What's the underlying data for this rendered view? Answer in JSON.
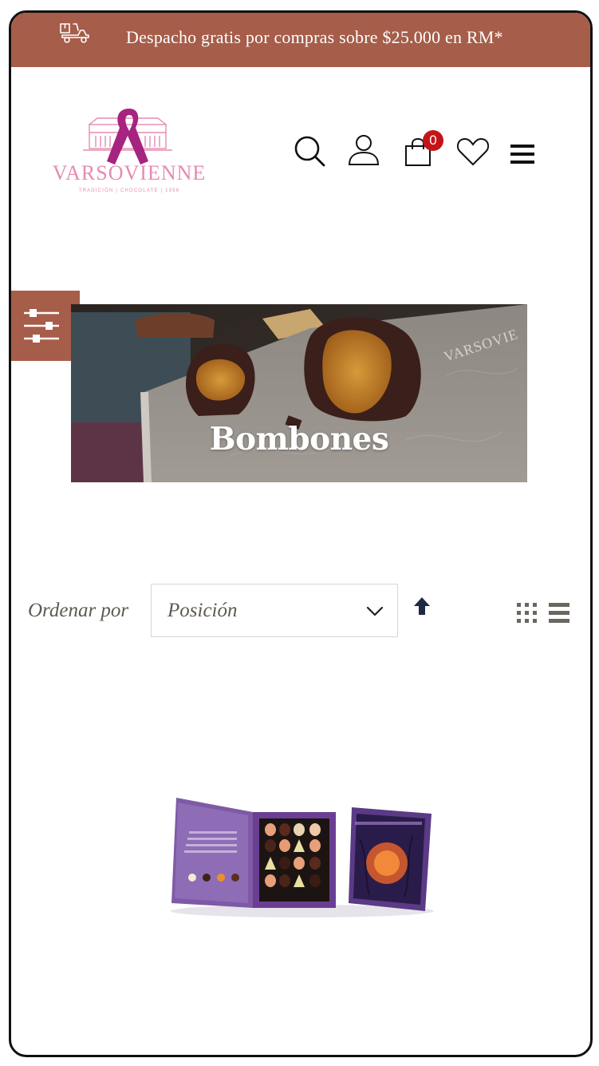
{
  "promo": {
    "text": "Despacho gratis por compras sobre $25.000 en RM*",
    "icon": "delivery-scooter-icon"
  },
  "header": {
    "logo_text": "VARSOVIENNE",
    "logo_tagline": "TRADICIÓN | CHOCOLATE | 1956",
    "cart_count": "0",
    "icons": [
      "search-icon",
      "user-icon",
      "shopping-bag-icon",
      "heart-icon",
      "hamburger-menu-icon"
    ]
  },
  "category": {
    "title": "Bombones"
  },
  "toolbar": {
    "sort_label": "Ordenar por",
    "sort_value": "Posición"
  },
  "colors": {
    "brand": "#a65d49",
    "badge": "#c4141a",
    "logo_pink": "#e58bb0",
    "ribbon": "#a6237f"
  }
}
